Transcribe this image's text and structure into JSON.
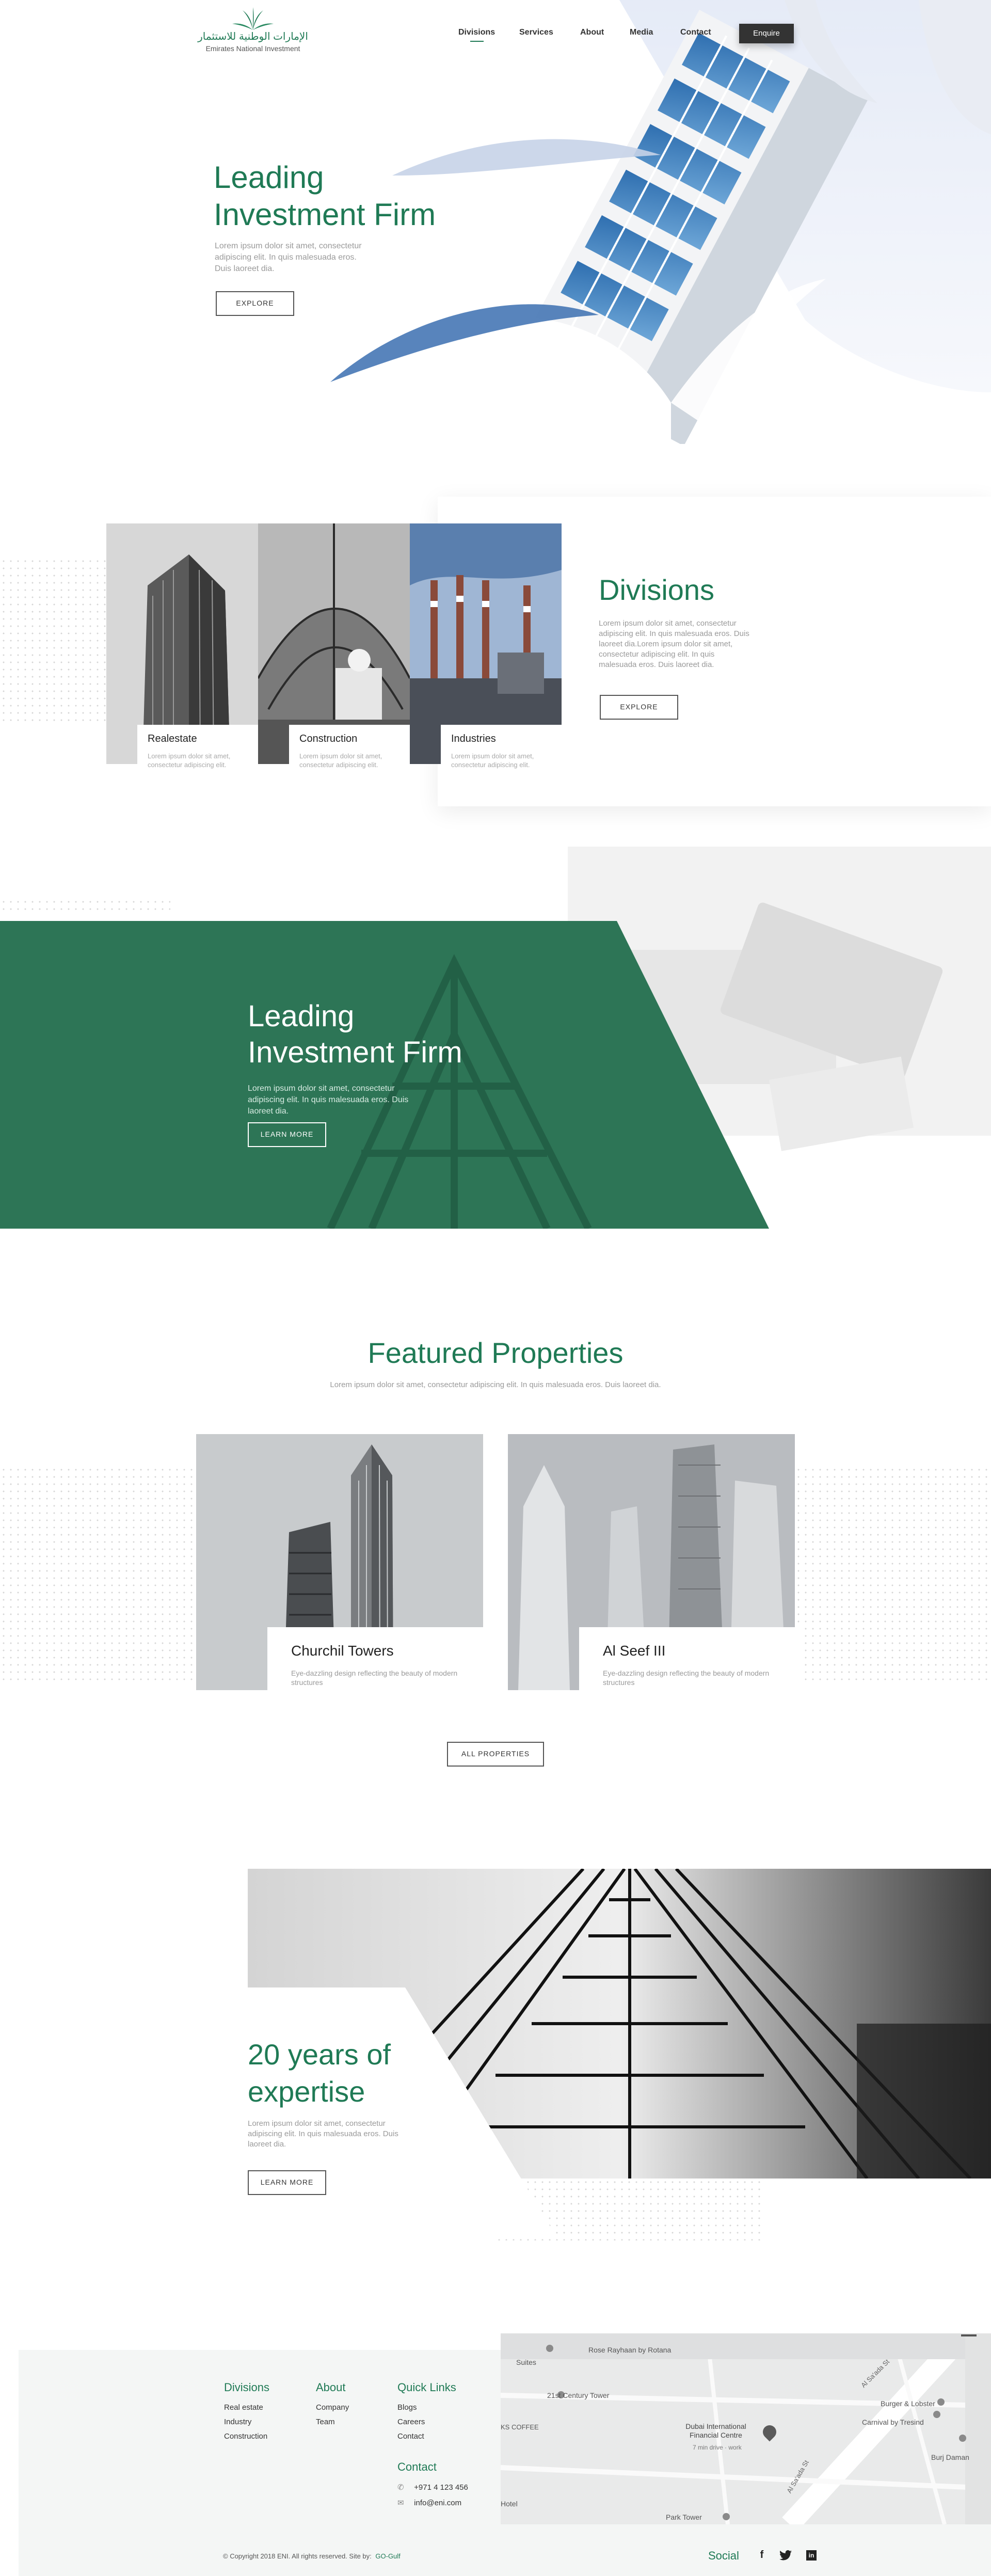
{
  "colors": {
    "brand": "#1f7a55",
    "dark": "#333333"
  },
  "header": {
    "logo_arabic": "الإمارات الوطنية للاستثمار",
    "logo_english": "Emirates National Investment",
    "nav": [
      "Divisions",
      "Services",
      "About",
      "Media",
      "Contact"
    ],
    "active_nav": "Divisions",
    "enquire_label": "Enquire"
  },
  "hero": {
    "title_line1": "Leading",
    "title_line2": "Investment Firm",
    "text": "Lorem ipsum dolor sit amet, consectetur adipiscing elit. In quis malesuada eros. Duis laoreet dia.",
    "button": "EXPLORE"
  },
  "divisions": {
    "title": "Divisions",
    "text": "Lorem ipsum dolor sit amet, consectetur adipiscing elit. In quis malesuada eros. Duis laoreet dia.Lorem ipsum dolor sit amet, consectetur adipiscing elit. In quis malesuada eros. Duis laoreet dia.",
    "button": "EXPLORE",
    "cards": [
      {
        "title": "Realestate",
        "text": "Lorem ipsum dolor sit amet, consectetur adipiscing elit."
      },
      {
        "title": "Construction",
        "text": "Lorem ipsum dolor sit amet, consectetur adipiscing elit."
      },
      {
        "title": "Industries",
        "text": "Lorem ipsum dolor sit amet, consectetur adipiscing elit."
      }
    ]
  },
  "banner": {
    "title_line1": "Leading",
    "title_line2": "Investment Firm",
    "text": "Lorem ipsum dolor sit amet, consectetur adipiscing elit. In quis malesuada eros. Duis laoreet dia.",
    "button": "LEARN MORE"
  },
  "featured": {
    "title": "Featured Properties",
    "subtitle": "Lorem ipsum dolor sit amet, consectetur adipiscing elit. In quis malesuada eros. Duis laoreet dia.",
    "properties": [
      {
        "title": "Churchil Towers",
        "text": "Eye-dazzling design reflecting the beauty of modern structures"
      },
      {
        "title": "Al Seef III",
        "text": "Eye-dazzling design reflecting the beauty of modern structures"
      }
    ],
    "button": "ALL PROPERTIES"
  },
  "expertise": {
    "title_line1": "20 years of",
    "title_line2": "expertise",
    "text": "Lorem ipsum dolor sit amet, consectetur adipiscing elit. In quis malesuada eros. Duis laoreet dia.",
    "button": "LEARN MORE"
  },
  "footer": {
    "divisions": {
      "heading": "Divisions",
      "items": [
        "Real estate",
        "Industry",
        "Construction"
      ]
    },
    "about": {
      "heading": "About",
      "items": [
        "Company",
        "Team"
      ]
    },
    "quick": {
      "heading": "Quick Links",
      "items": [
        "Blogs",
        "Careers",
        "Contact"
      ]
    },
    "contact": {
      "heading": "Contact",
      "phone": "+971 4 123 456",
      "email": "info@eni.com"
    },
    "copyright": "© Copyright 2018 ENI. All rights reserved. Site by:",
    "credit": "GO-Gulf",
    "social_label": "Social",
    "map": {
      "labels": [
        "Rose Rayhaan by Rotana",
        "21st Century Tower",
        "Dubai International Financial Centre",
        "7 min drive · work",
        "Burger & Lobster",
        "Carnival by Tresind",
        "Burj Daman",
        "Park Tower",
        "Al Sa'ada St",
        "Al Sa'ada St",
        "Suites",
        "KS COFFEE",
        "Hotel"
      ]
    }
  }
}
